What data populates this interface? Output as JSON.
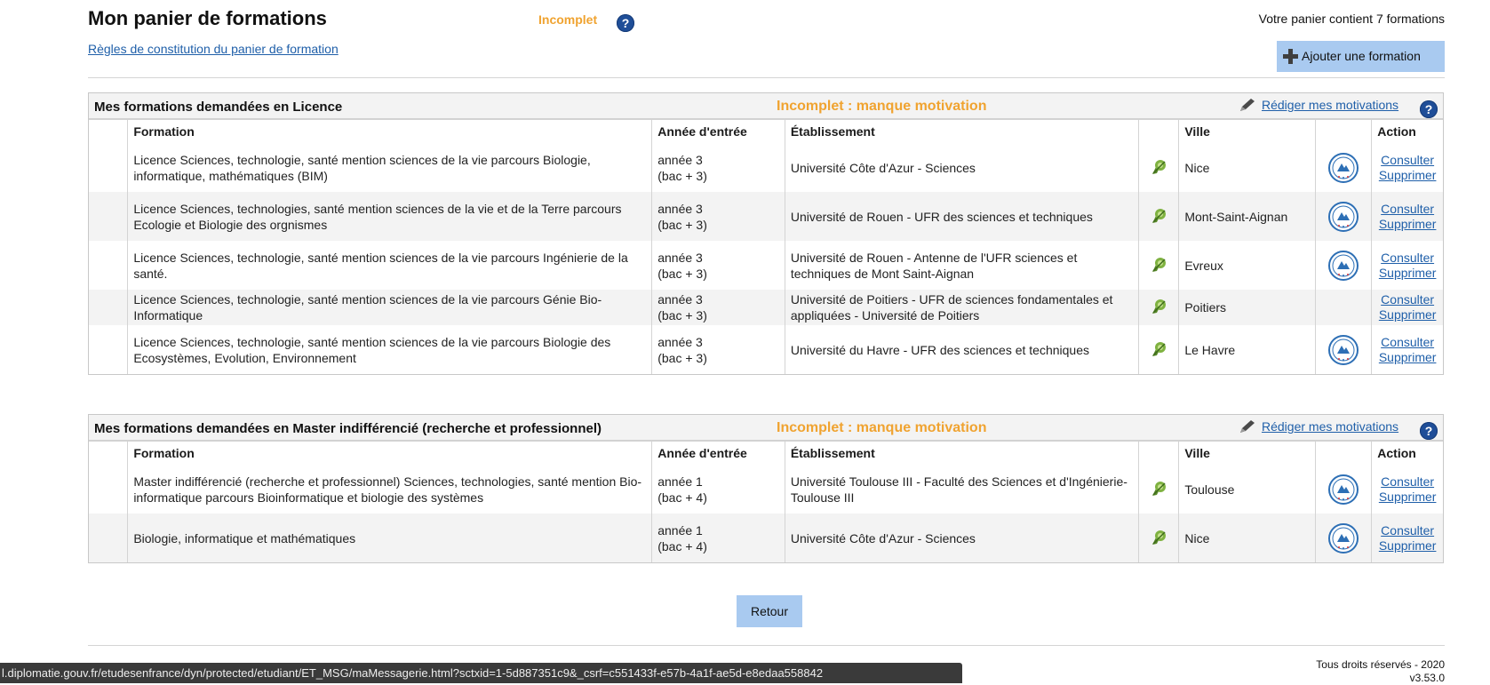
{
  "header": {
    "title": "Mon panier de formations",
    "status": "Incomplet",
    "help": "?",
    "rules_link": "Règles de constitution du panier de formation",
    "count_text": "Votre panier contient 7 formations",
    "add_button": "Ajouter une formation"
  },
  "columns": {
    "formation": "Formation",
    "annee": "Année d'entrée",
    "etablissement": "Établissement",
    "ville": "Ville",
    "action": "Action"
  },
  "actions": {
    "consulter": "Consulter",
    "supprimer": "Supprimer"
  },
  "licence": {
    "title": "Mes formations demandées en Licence",
    "status": "Incomplet : manque motivation",
    "motivation_link": "Rédiger mes motivations",
    "rows": [
      {
        "formation": "Licence Sciences, technologie, santé mention sciences de la vie parcours Biologie, informatique, mathématiques (BIM)",
        "annee": "année 3",
        "bac": "(bac + 3)",
        "etablissement": "Université Côte d'Azur - Sciences",
        "ville": "Nice",
        "badge": true
      },
      {
        "formation": "Licence Sciences, technologies, santé mention sciences de la vie et de la Terre parcours Ecologie et Biologie des orgnismes",
        "annee": "année 3",
        "bac": "(bac + 3)",
        "etablissement": "Université de Rouen - UFR des sciences et techniques",
        "ville": "Mont-Saint-Aignan",
        "badge": true
      },
      {
        "formation": "Licence Sciences, technologie, santé mention sciences de la vie parcours Ingénierie de la santé.",
        "annee": "année 3",
        "bac": "(bac + 3)",
        "etablissement": "Université de Rouen - Antenne de l'UFR sciences et techniques de Mont Saint-Aignan",
        "ville": "Evreux",
        "badge": true
      },
      {
        "formation": "Licence Sciences, technologie, santé mention sciences de la vie parcours Génie Bio-Informatique",
        "annee": "année 3",
        "bac": "(bac + 3)",
        "etablissement": "Université de Poitiers - UFR de sciences fondamentales et appliquées - Université de Poitiers",
        "ville": "Poitiers",
        "badge": false
      },
      {
        "formation": "Licence Sciences, technologie, santé mention sciences de la vie parcours Biologie des Ecosystèmes, Evolution, Environnement",
        "annee": "année 3",
        "bac": "(bac + 3)",
        "etablissement": "Université du Havre - UFR des sciences et techniques",
        "ville": "Le Havre",
        "badge": true
      }
    ]
  },
  "master": {
    "title": "Mes formations demandées en Master indifférencié (recherche et professionnel)",
    "status": "Incomplet : manque motivation",
    "motivation_link": "Rédiger mes motivations",
    "rows": [
      {
        "formation": "Master indifférencié (recherche et professionnel) Sciences, technologies, santé mention Bio-informatique parcours Bioinformatique et biologie des systèmes",
        "annee": "année 1",
        "bac": "(bac + 4)",
        "etablissement": "Université Toulouse III - Faculté des Sciences et d'Ingénierie-Toulouse III",
        "ville": "Toulouse",
        "badge": true
      },
      {
        "formation": "Biologie, informatique et mathématiques",
        "annee": "année 1",
        "bac": "(bac + 4)",
        "etablissement": "Université Côte d'Azur - Sciences",
        "ville": "Nice",
        "badge": true
      }
    ]
  },
  "footer": {
    "retour": "Retour",
    "copyright": "Tous droits réservés - 2020",
    "version": "v3.53.0"
  },
  "statusbar": {
    "url": "l.diplomatie.gouv.fr/etudesenfrance/dyn/protected/etudiant/ET_MSG/maMessagerie.html?sctxid=1-5d887351c9&_csrf=c551433f-e57b-4a1f-ae5d-e8edaa558842"
  },
  "colors": {
    "accent_orange": "#f0a330",
    "link_blue": "#1f5fa9",
    "button_blue": "#a9caf0",
    "help_blue": "#1f4e98"
  },
  "icons": {
    "help": "help-icon",
    "plus": "plus-icon",
    "pencil": "pencil-icon",
    "location": "location-pin-icon",
    "badge": "bienvenue-badge-icon"
  }
}
